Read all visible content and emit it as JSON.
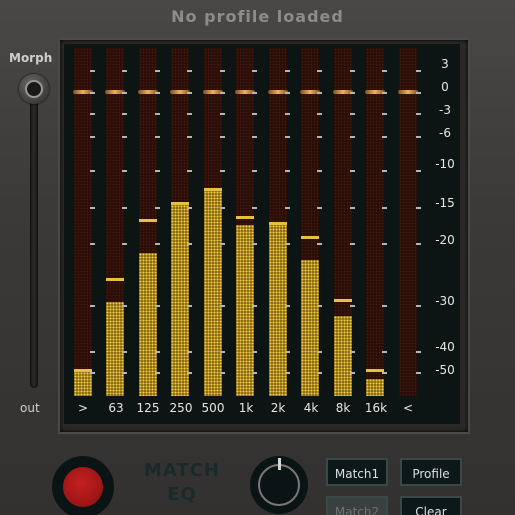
{
  "header": {
    "title": "No profile loaded"
  },
  "morph": {
    "label": "Morph",
    "out_label": "out"
  },
  "scale_labels": [
    "3",
    "0",
    "-3",
    "-6",
    "-10",
    "-15",
    "-20",
    "-30",
    "-40",
    "-50"
  ],
  "bands": [
    {
      "label": ">",
      "level": 0.07,
      "peak": 0.07
    },
    {
      "label": "63",
      "level": 0.27,
      "peak": 0.33
    },
    {
      "label": "125",
      "level": 0.41,
      "peak": 0.5
    },
    {
      "label": "250",
      "level": 0.55,
      "peak": 0.55
    },
    {
      "label": "500",
      "level": 0.59,
      "peak": 0.59
    },
    {
      "label": "1k",
      "level": 0.49,
      "peak": 0.51
    },
    {
      "label": "2k",
      "level": 0.49,
      "peak": 0.49
    },
    {
      "label": "4k",
      "level": 0.39,
      "peak": 0.45
    },
    {
      "label": "8k",
      "level": 0.23,
      "peak": 0.27
    },
    {
      "label": "16k",
      "level": 0.05,
      "peak": 0.07
    },
    {
      "label": "<",
      "level": 0.0,
      "peak": 0.0
    }
  ],
  "bottom": {
    "match_title_line1": "MATCH",
    "match_title_line2": "EQ",
    "btn_match1": "Match1",
    "btn_profile": "Profile",
    "btn_match2": "Match2",
    "btn_clear": "Clear"
  },
  "colors": {
    "meter": "#c8a020",
    "power": "#c42020",
    "screen": "#0d1414"
  }
}
